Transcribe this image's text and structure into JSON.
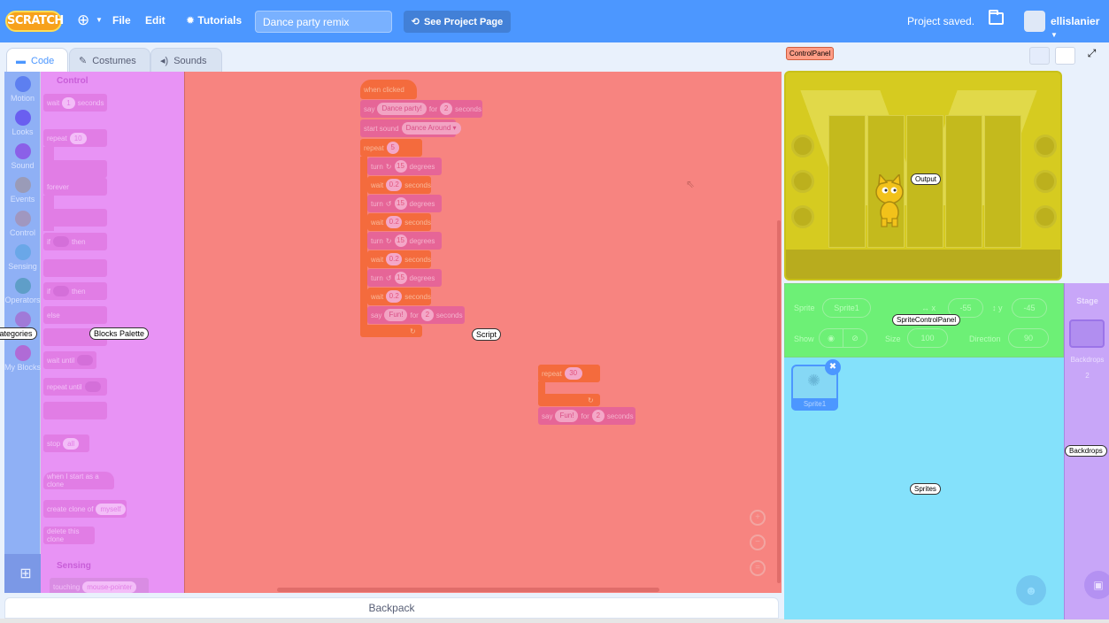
{
  "menubar": {
    "logo": "SCRATCH",
    "file": "File",
    "edit": "Edit",
    "tutorials": "Tutorials",
    "project_title": "Dance party remix",
    "see_project_page": "See Project Page",
    "status": "Project saved.",
    "username": "ellislanier"
  },
  "tabs": [
    {
      "label": "Code"
    },
    {
      "label": "Costumes"
    },
    {
      "label": "Sounds"
    }
  ],
  "categories": [
    {
      "label": "Motion",
      "color": "#4c97ff"
    },
    {
      "label": "Looks",
      "color": "#9966ff"
    },
    {
      "label": "Sound",
      "color": "#cf63cf"
    },
    {
      "label": "Events",
      "color": "#ffbf00"
    },
    {
      "label": "Control",
      "color": "#ffab19"
    },
    {
      "label": "Sensing",
      "color": "#5cb1d6"
    },
    {
      "label": "Operators",
      "color": "#59c059"
    },
    {
      "label": "Variables",
      "color": "#ff8c1a"
    },
    {
      "label": "My Blocks",
      "color": "#ff6680"
    }
  ],
  "overlay_labels": {
    "block_categories": "BlockCategories",
    "blocks_palette": "Blocks Palette",
    "script": "Script",
    "control_panel": "ControlPanel",
    "output": "Output",
    "sprite_control_panel": "SpriteControlPanel",
    "sprites": "Sprites",
    "backdrops": "Backdrops"
  },
  "palette": {
    "control_heading": "Control",
    "sensing_heading": "Sensing",
    "wait": "wait",
    "wait_num": "1",
    "seconds": "seconds",
    "repeat": "repeat",
    "repeat_num": "10",
    "forever": "forever",
    "if": "if",
    "then": "then",
    "else": "else",
    "wait_until": "wait until",
    "repeat_until": "repeat until",
    "stop": "stop",
    "stop_opt": "all",
    "when_clone": "when I start as a clone",
    "create_clone": "create clone of",
    "clone_opt": "myself",
    "delete_clone": "delete this clone",
    "touching": "touching",
    "touching_opt": "mouse-pointer"
  },
  "script": {
    "hat": "when clicked",
    "say1": "say",
    "say1_text": "Dance party!",
    "for": "for",
    "say1_secs": "2",
    "seconds": "seconds",
    "start_sound": "start sound",
    "sound_name": "Dance Around",
    "repeat": "repeat",
    "repeat_num": "5",
    "turn": "turn",
    "degrees": "degrees",
    "turn_num": "15",
    "wait": "wait",
    "wait_num": "0.2",
    "say2": "say",
    "say2_text": "Fun!",
    "say2_secs": "2",
    "repeat2_num": "30"
  },
  "backpack": "Backpack",
  "sprite_info": {
    "sprite_label": "Sprite",
    "sprite_name": "Sprite1",
    "x_label": "x",
    "x_value": "-55",
    "y_label": "y",
    "y_value": "-45",
    "show_label": "Show",
    "size_label": "Size",
    "size_value": "100",
    "direction_label": "Direction",
    "direction_value": "90"
  },
  "sprites": [
    {
      "name": "Sprite1"
    }
  ],
  "stage_pane": {
    "title": "Stage",
    "backdrops_label": "Backdrops",
    "backdrops_count": "2"
  }
}
